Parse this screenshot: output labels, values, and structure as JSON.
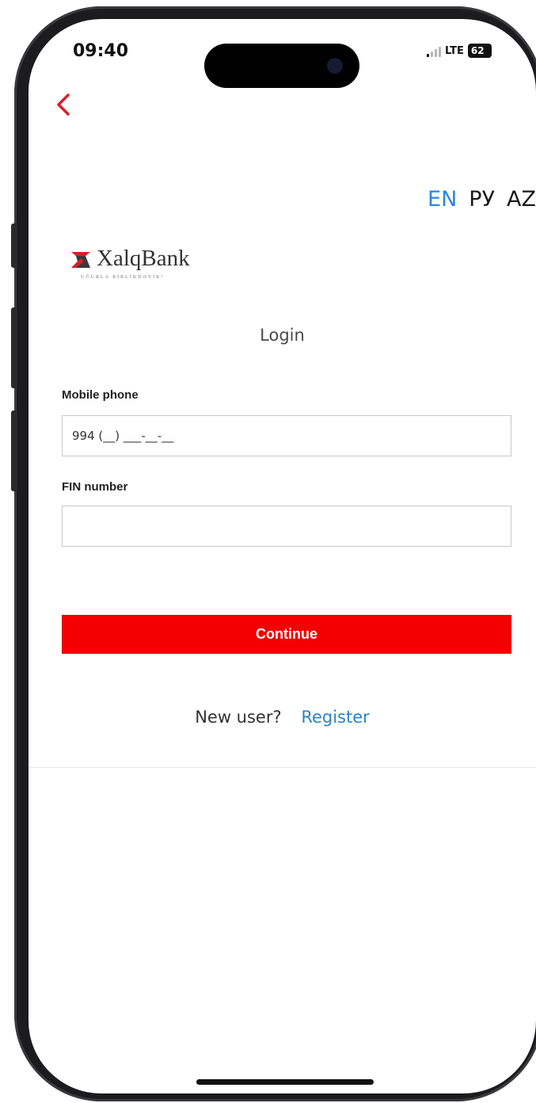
{
  "status_bar": {
    "time": "09:40",
    "network": "LTE",
    "battery": "62"
  },
  "nav": {
    "back_icon": "chevron-left-icon"
  },
  "languages": [
    {
      "code": "EN",
      "active": true
    },
    {
      "code": "РУ",
      "active": false
    },
    {
      "code": "AZ",
      "active": false
    }
  ],
  "brand": {
    "name": "XalqBank",
    "tagline": "UĞURLA BİRLİKDƏYİK!"
  },
  "login": {
    "title": "Login",
    "phone_label": "Mobile phone",
    "phone_value": "994 (__) ___-__-__",
    "fin_label": "FIN number",
    "fin_value": "",
    "continue_label": "Continue"
  },
  "footer": {
    "new_user": "New user?",
    "register": "Register"
  },
  "colors": {
    "accent_red": "#f40000",
    "link_blue": "#2b82c9",
    "active_lang": "#2f86d6"
  }
}
